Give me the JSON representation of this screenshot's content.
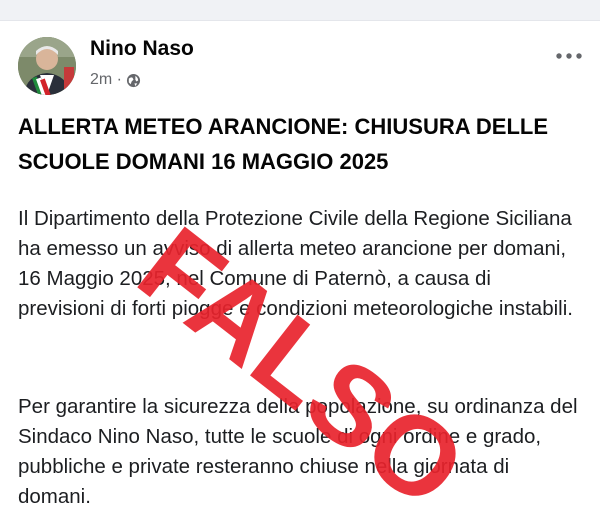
{
  "post": {
    "author": "Nino Naso",
    "time": "2m ·",
    "title": "ALLERTA METEO ARANCIONE: CHIUSURA DELLE SCUOLE DOMANI 16 MAGGIO 2025",
    "paragraphs": [
      "Il Dipartimento della Protezione Civile della Regione Siciliana ha emesso un avviso di allerta meteo arancione per domani, 16 Maggio 2025, nel Comune di Paternò, a causa di previsioni di forti piogge e condizioni meteorologiche instabili.",
      "Per garantire la sicurezza della popolazione, su ordinanza del Sindaco Nino Naso, tutte le scuole di ogni ordine e grado, pubbliche e private resteranno chiuse nella giornata di domani."
    ]
  },
  "stamp": {
    "text": "FALSO",
    "color": "#e8232c"
  },
  "icons": {
    "privacy": "globe-icon",
    "menu": "more-options-icon"
  }
}
